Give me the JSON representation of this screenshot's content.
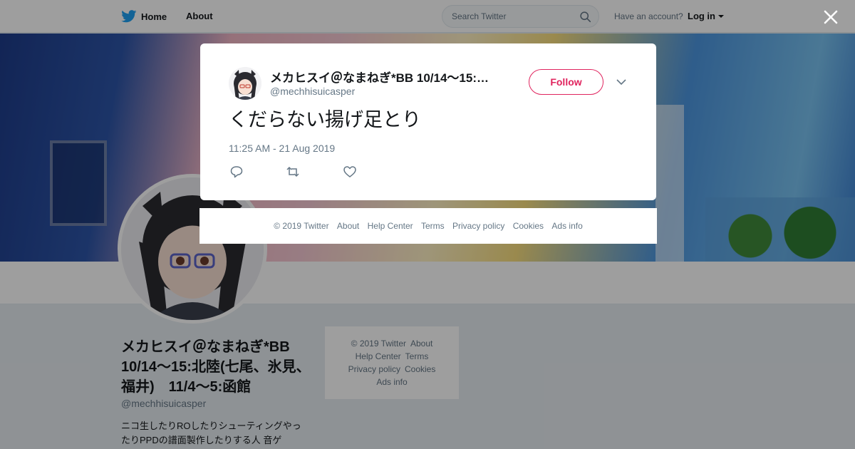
{
  "colors": {
    "twitter_blue": "#1da1f2",
    "like_red": "#e0245e",
    "gray_text": "#657786"
  },
  "topbar": {
    "home_label": "Home",
    "about_label": "About",
    "search_placeholder": "Search Twitter",
    "have_account": "Have an account?",
    "login_label": "Log in"
  },
  "profile": {
    "name": "メカヒスイ＠なまねぎ*BB 10/14～15:北陸(七尾、氷見、福井)　11/4～5:函館",
    "handle": "@mechhisuicasper",
    "bio": "ニコ生したりROしたりシューティングやったりPPDの譜面製作したりする人 音ゲ"
  },
  "side_footer": {
    "copyright": "© 2019 Twitter",
    "about": "About",
    "help": "Help Center",
    "terms": "Terms",
    "privacy": "Privacy policy",
    "cookies": "Cookies",
    "ads": "Ads info"
  },
  "tweet": {
    "author_name": "メカヒスイ＠なまねぎ*BB 10/14～15:北陸(七尾、氷見、福井)　11/4～5:函館",
    "author_handle": "@mechhisuicasper",
    "follow_label": "Follow",
    "text": "くだらない揚げ足とり",
    "timestamp": "11:25 AM - 21 Aug 2019"
  },
  "modal_footer": {
    "copyright": "© 2019 Twitter",
    "about": "About",
    "help": "Help Center",
    "terms": "Terms",
    "privacy": "Privacy policy",
    "cookies": "Cookies",
    "ads": "Ads info"
  },
  "icons": {
    "logo": "twitter-bird-icon",
    "search": "search-icon",
    "close": "close-icon",
    "more": "chevron-down-icon",
    "reply": "reply-icon",
    "retweet": "retweet-icon",
    "like": "heart-icon"
  }
}
